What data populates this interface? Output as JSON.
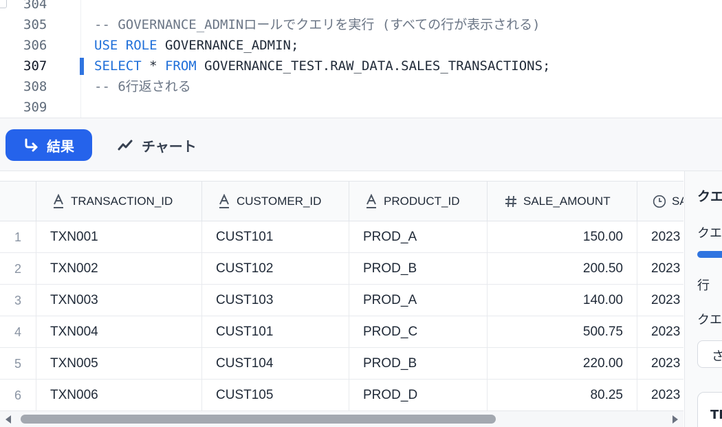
{
  "editor": {
    "lines": [
      {
        "no": "304",
        "segments": []
      },
      {
        "no": "305",
        "segments": [
          {
            "t": "-- GOVERNANCE_ADMINロールでクエリを実行 (すべての行が表示される)",
            "c": "cm"
          }
        ]
      },
      {
        "no": "306",
        "segments": [
          {
            "t": "USE ROLE",
            "c": "kw"
          },
          {
            "t": " GOVERNANCE_ADMIN;",
            "c": ""
          }
        ]
      },
      {
        "no": "307",
        "segments": [
          {
            "t": "SELECT",
            "c": "kw"
          },
          {
            "t": " * ",
            "c": ""
          },
          {
            "t": "FROM",
            "c": "kw"
          },
          {
            "t": " GOVERNANCE_TEST.RAW_DATA.SALES_TRANSACTIONS;",
            "c": ""
          }
        ],
        "active": true
      },
      {
        "no": "308",
        "segments": [
          {
            "t": "-- 6行返される",
            "c": "cm"
          }
        ]
      },
      {
        "no": "309",
        "segments": []
      }
    ]
  },
  "toolbar": {
    "results_label": "結果",
    "chart_label": "チャート"
  },
  "table": {
    "columns": [
      {
        "label": "TRANSACTION_ID",
        "icon": "text-type-icon",
        "glyph": "A"
      },
      {
        "label": "CUSTOMER_ID",
        "icon": "text-type-icon",
        "glyph": "A"
      },
      {
        "label": "PRODUCT_ID",
        "icon": "text-type-icon",
        "glyph": "A"
      },
      {
        "label": "SALE_AMOUNT",
        "icon": "number-type-icon",
        "glyph": "#"
      },
      {
        "label": "SA",
        "icon": "timestamp-type-icon",
        "glyph": "◷"
      }
    ],
    "rows": [
      {
        "n": "1",
        "id": "TXN001",
        "cust": "CUST101",
        "prod": "PROD_A",
        "amt": "150.00",
        "date": "2023"
      },
      {
        "n": "2",
        "id": "TXN002",
        "cust": "CUST102",
        "prod": "PROD_B",
        "amt": "200.50",
        "date": "2023"
      },
      {
        "n": "3",
        "id": "TXN003",
        "cust": "CUST103",
        "prod": "PROD_A",
        "amt": "140.00",
        "date": "2023"
      },
      {
        "n": "4",
        "id": "TXN004",
        "cust": "CUST101",
        "prod": "PROD_C",
        "amt": "500.75",
        "date": "2023"
      },
      {
        "n": "5",
        "id": "TXN005",
        "cust": "CUST104",
        "prod": "PROD_B",
        "amt": "220.00",
        "date": "2023"
      },
      {
        "n": "6",
        "id": "TXN006",
        "cust": "CUST105",
        "prod": "PROD_D",
        "amt": "80.25",
        "date": "2023"
      }
    ],
    "scroll_visible_fraction": 0.73
  },
  "side_panel": {
    "title": "クエ",
    "label1": "クエ",
    "label2": "行",
    "label3": "クエ",
    "select_value": "さ",
    "card_text": "TI",
    "accent": "#2f74e0"
  },
  "colors": {
    "primary": "#2563eb",
    "keyword": "#1f6fd9",
    "comment": "#6b7686"
  }
}
